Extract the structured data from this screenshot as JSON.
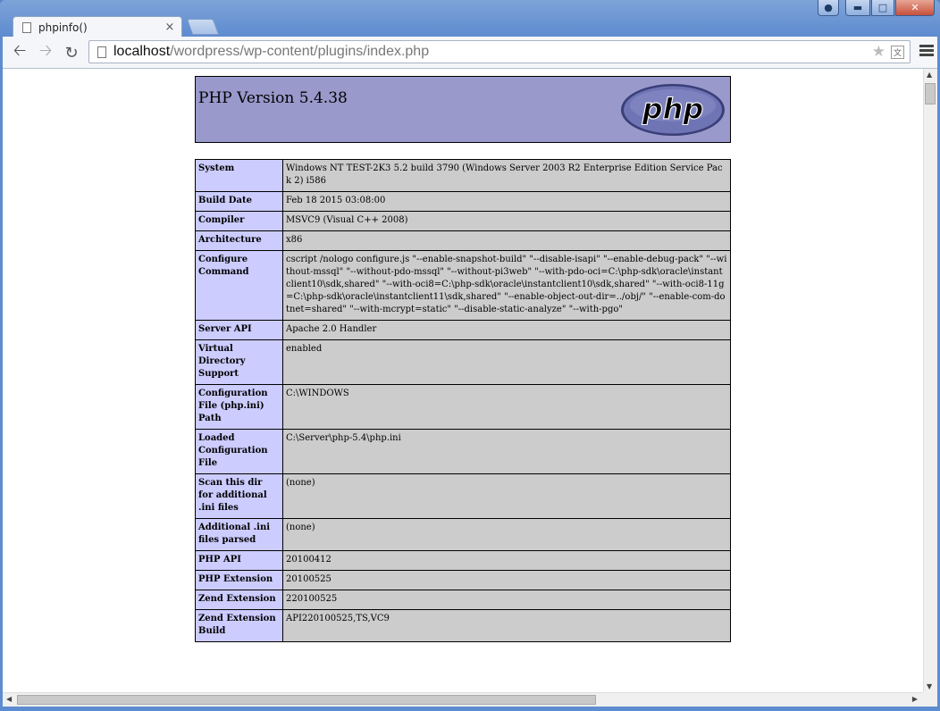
{
  "browser": {
    "tab_title": "phpinfo()",
    "tab_close": "×",
    "url_host": "localhost",
    "url_path": "/wordpress/wp-content/plugins/index.php"
  },
  "php": {
    "version_heading": "PHP Version 5.4.38",
    "logo_text": "php",
    "rows": [
      {
        "label": "System",
        "value": "Windows NT TEST-2K3 5.2 build 3790 (Windows Server 2003 R2 Enterprise Edition Service Pack 2) i586"
      },
      {
        "label": "Build Date",
        "value": "Feb 18 2015 03:08:00"
      },
      {
        "label": "Compiler",
        "value": "MSVC9 (Visual C++ 2008)"
      },
      {
        "label": "Architecture",
        "value": "x86"
      },
      {
        "label": "Configure Command",
        "value": "cscript /nologo configure.js \"--enable-snapshot-build\" \"--disable-isapi\" \"--enable-debug-pack\" \"--without-mssql\" \"--without-pdo-mssql\" \"--without-pi3web\" \"--with-pdo-oci=C:\\php-sdk\\oracle\\instantclient10\\sdk,shared\" \"--with-oci8=C:\\php-sdk\\oracle\\instantclient10\\sdk,shared\" \"--with-oci8-11g=C:\\php-sdk\\oracle\\instantclient11\\sdk,shared\" \"--enable-object-out-dir=../obj/\" \"--enable-com-dotnet=shared\" \"--with-mcrypt=static\" \"--disable-static-analyze\" \"--with-pgo\""
      },
      {
        "label": "Server API",
        "value": "Apache 2.0 Handler"
      },
      {
        "label": "Virtual Directory Support",
        "value": "enabled"
      },
      {
        "label": "Configuration File (php.ini) Path",
        "value": "C:\\WINDOWS"
      },
      {
        "label": "Loaded Configuration File",
        "value": "C:\\Server\\php-5.4\\php.ini"
      },
      {
        "label": "Scan this dir for additional .ini files",
        "value": "(none)"
      },
      {
        "label": "Additional .ini files parsed",
        "value": "(none)"
      },
      {
        "label": "PHP API",
        "value": "20100412"
      },
      {
        "label": "PHP Extension",
        "value": "20100525"
      },
      {
        "label": "Zend Extension",
        "value": "220100525"
      },
      {
        "label": "Zend Extension Build",
        "value": "API220100525,TS,VC9"
      }
    ]
  }
}
